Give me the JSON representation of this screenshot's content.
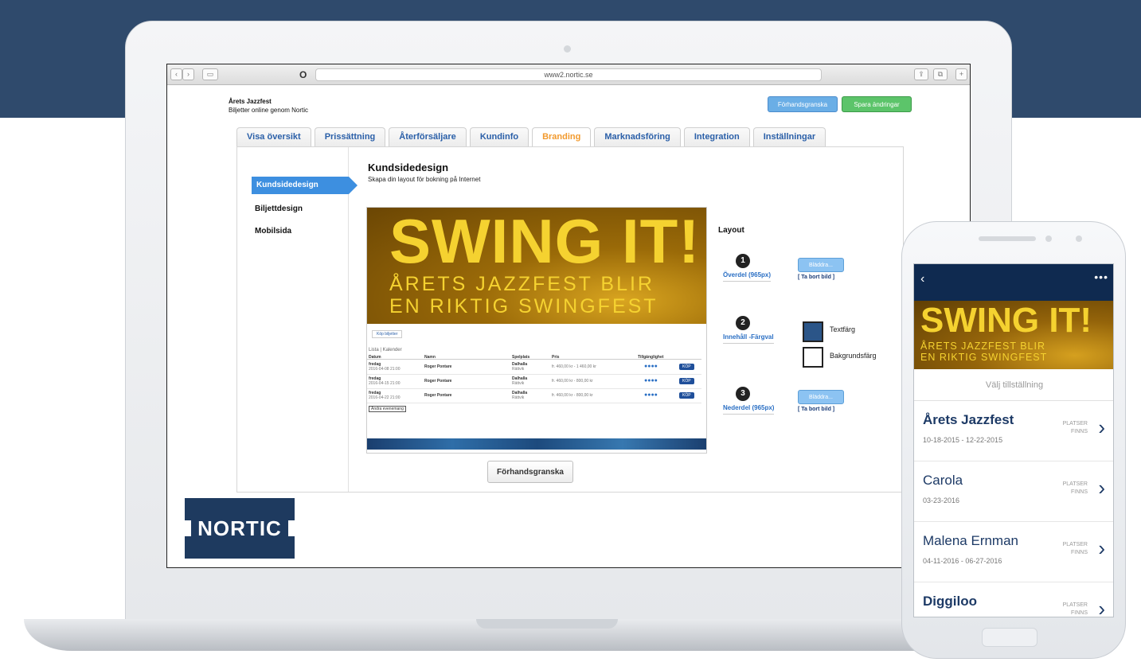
{
  "browser": {
    "url": "www2.nortic.se"
  },
  "event": {
    "title": "Årets Jazzfest",
    "subtitle": "Biljetter online genom Nortic"
  },
  "header_buttons": {
    "preview": "Förhandsgranska",
    "save": "Spara ändringar"
  },
  "tabs": [
    {
      "label": "Visa översikt",
      "active": false
    },
    {
      "label": "Prissättning",
      "active": false
    },
    {
      "label": "Återförsäljare",
      "active": false
    },
    {
      "label": "Kundinfo",
      "active": false
    },
    {
      "label": "Branding",
      "active": true
    },
    {
      "label": "Marknadsföring",
      "active": false
    },
    {
      "label": "Integration",
      "active": false
    },
    {
      "label": "Inställningar",
      "active": false
    }
  ],
  "sidebar": {
    "items": [
      {
        "label": "Kundsidedesign",
        "active": true
      },
      {
        "label": "Biljettdesign",
        "active": false
      },
      {
        "label": "Mobilsida",
        "active": false
      }
    ]
  },
  "main": {
    "title": "Kundsidedesign",
    "subtitle": "Skapa din layout för bokning på Internet",
    "preview_button": "Förhandsgranska"
  },
  "banner": {
    "headline": "SWING IT!",
    "line1": "ÅRETS JAZZFEST BLIR",
    "line2": "EN RIKTIG SWINGFEST"
  },
  "mini_table": {
    "tab": "Köp biljetter",
    "list_label": "Lista | Kalender",
    "headers": [
      "Datum",
      "Namn",
      "Spelplats",
      "Pris",
      "Tillgänglighet"
    ],
    "rows": [
      {
        "day": "fredag",
        "date": "2016-04-08 21:00",
        "name": "Roger Pontare",
        "venue": "Dalhalla",
        "venue_sub": "Rättvik",
        "price": "fr. 460,00 kr - 1 460,00 kr",
        "avail": "●●●●",
        "buy": "KÖP"
      },
      {
        "day": "fredag",
        "date": "2016-04-15 21:00",
        "name": "Roger Pontare",
        "venue": "Dalhalla",
        "venue_sub": "Rättvik",
        "price": "fr. 460,00 kr - 800,00 kr",
        "avail": "●●●●",
        "buy": "KÖP"
      },
      {
        "day": "fredag",
        "date": "2016-04-22 21:00",
        "name": "Roger Pontare",
        "venue": "Dalhalla",
        "venue_sub": "Rättvik",
        "price": "fr. 460,00 kr - 800,00 kr",
        "avail": "●●●●",
        "buy": "KÖP"
      }
    ],
    "change_link": "Ändra evenemang"
  },
  "layout": {
    "title": "Layout",
    "sections": [
      {
        "num": "1",
        "label": "Överdel (965px)",
        "browse": "Bläddra...",
        "remove": "[ Ta bort bild ]"
      },
      {
        "num": "2",
        "label": "Innehåll -Färgval",
        "text_color": "Textfärg",
        "bg_color": "Bakgrundsfärg"
      },
      {
        "num": "3",
        "label": "Nederdel (965px)",
        "browse": "Bläddra...",
        "remove": "[ Ta bort bild ]"
      }
    ]
  },
  "logo": {
    "text": "NORTIC"
  },
  "phone": {
    "back": "‹",
    "more": "•••",
    "banner_headline": "SWING IT!",
    "banner_line1": "ÅRETS JAZZFEST BLIR",
    "banner_line2": "EN RIKTIG SWINGFEST",
    "select_label": "Välj tillställning",
    "events": [
      {
        "name": "Årets Jazzfest",
        "date": "10-18-2015 - 12-22-2015",
        "status": "PLATSER\nFINNS"
      },
      {
        "name": "Carola",
        "date": "03-23-2016",
        "status": "PLATSER\nFINNS"
      },
      {
        "name": "Malena Ernman",
        "date": "04-11-2016 - 06-27-2016",
        "status": "PLATSER\nFINNS"
      },
      {
        "name": "Diggiloo",
        "date": "",
        "status": "PLATSER\nFINNS"
      }
    ]
  },
  "colors": {
    "background_band": "#2f4a6c",
    "tab_text": "#2a5fa8",
    "tab_active": "#f29a2e",
    "sidebar_active": "#3d8fe0",
    "banner_yellow": "#f5d230",
    "logo_bg": "#1e3a5f",
    "save_green": "#5cc46a"
  }
}
